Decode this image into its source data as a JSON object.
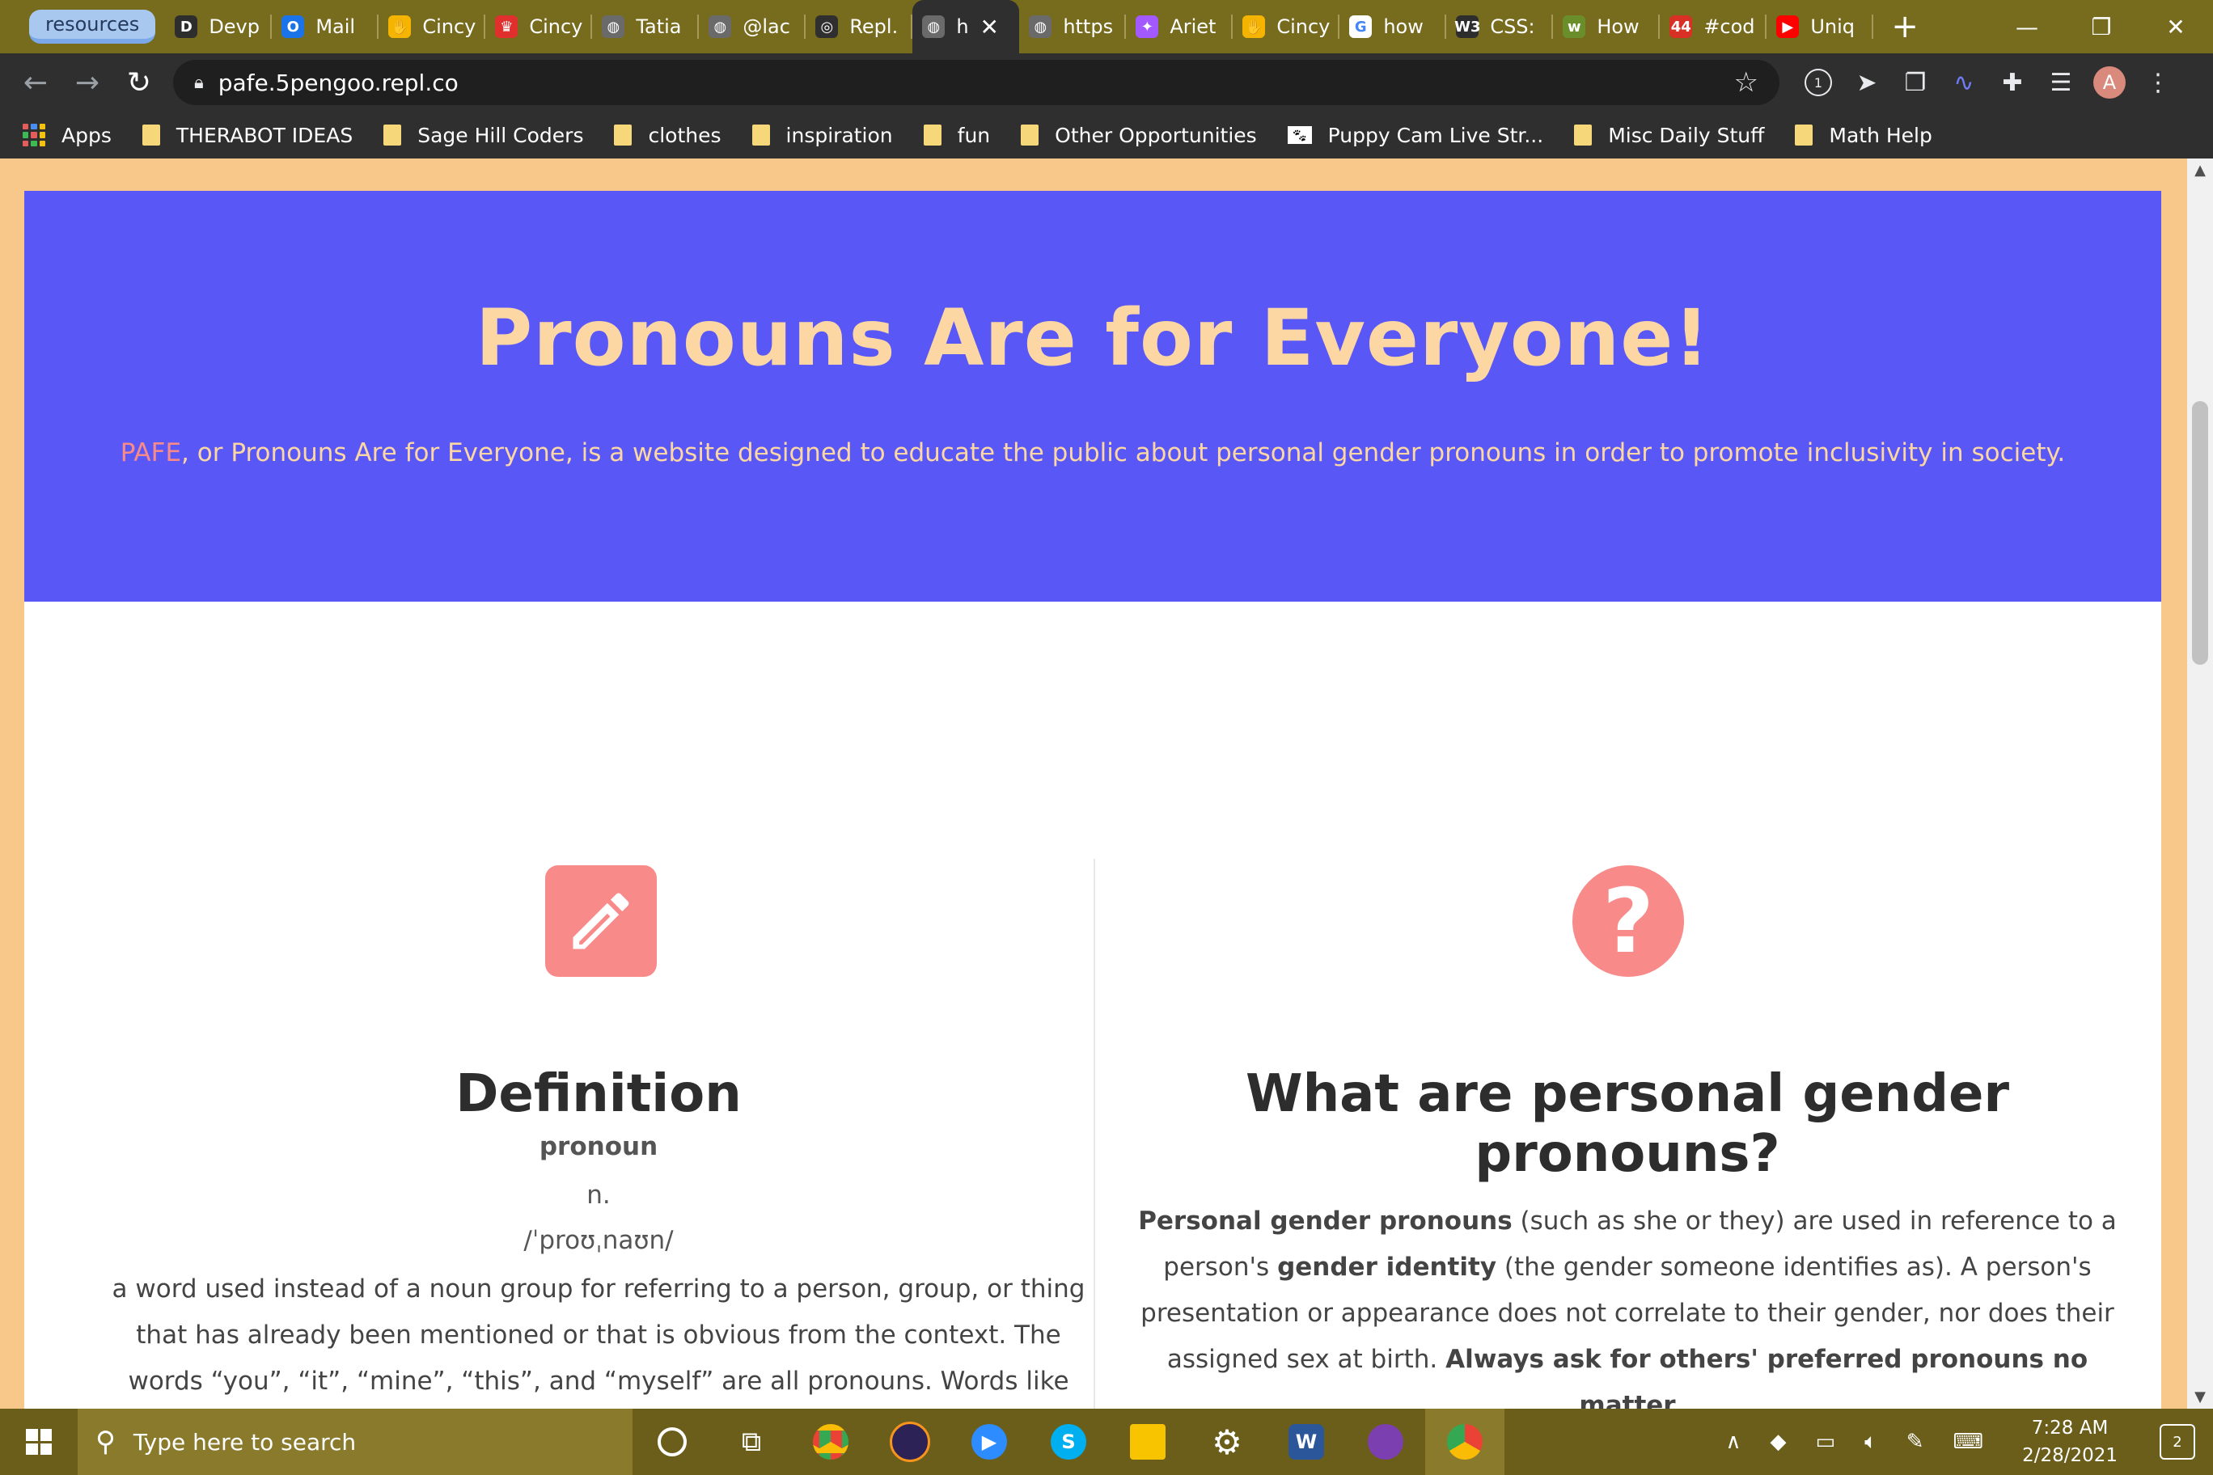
{
  "browser": {
    "tab_group": "resources",
    "tabs": [
      {
        "title": "Devp",
        "icon": "devpost-icon",
        "color": "#2d2d2d",
        "glyph": "D"
      },
      {
        "title": "Mail",
        "icon": "outlook-icon",
        "color": "#1a73e8",
        "glyph": "O"
      },
      {
        "title": "Cincy",
        "icon": "hackathon-icon",
        "color": "#f4b400",
        "glyph": "✋"
      },
      {
        "title": "Cincy",
        "icon": "crown-icon",
        "color": "#e0302e",
        "glyph": "♛"
      },
      {
        "title": "Tatia",
        "icon": "globe-icon",
        "color": "#6a6a6a",
        "glyph": "◍"
      },
      {
        "title": "@lac",
        "icon": "globe-icon",
        "color": "#6a6a6a",
        "glyph": "◍"
      },
      {
        "title": "Repl.",
        "icon": "replit-icon",
        "color": "#2f2f2f",
        "glyph": "◎"
      },
      {
        "title": "h",
        "icon": "globe-icon",
        "color": "#6a6a6a",
        "glyph": "◍",
        "active": true
      },
      {
        "title": "https",
        "icon": "globe-icon",
        "color": "#6a6a6a",
        "glyph": "◍"
      },
      {
        "title": "Ariet",
        "icon": "figma-icon",
        "color": "#a259ff",
        "glyph": "✦"
      },
      {
        "title": "Cincy",
        "icon": "hackathon-icon",
        "color": "#f4b400",
        "glyph": "✋"
      },
      {
        "title": "how",
        "icon": "google-icon",
        "color": "#ffffff",
        "glyph": "G"
      },
      {
        "title": "CSS:",
        "icon": "w3schools-icon",
        "color": "#2d2d2d",
        "glyph": "W3"
      },
      {
        "title": "How",
        "icon": "wikihow-icon",
        "color": "#6a8f2a",
        "glyph": "w"
      },
      {
        "title": "#cod",
        "icon": "calendar-icon",
        "color": "#d93025",
        "glyph": "44"
      },
      {
        "title": "Uniq",
        "icon": "youtube-icon",
        "color": "#ff0000",
        "glyph": "▶"
      }
    ],
    "url": "pafe.5pengoo.repl.co",
    "profile_initial": "A",
    "extension_badge": "1",
    "bookmarks": [
      {
        "label": "Apps",
        "type": "apps"
      },
      {
        "label": "THERABOT IDEAS",
        "type": "folder"
      },
      {
        "label": "Sage Hill Coders",
        "type": "folder"
      },
      {
        "label": "clothes",
        "type": "folder"
      },
      {
        "label": "inspiration",
        "type": "folder"
      },
      {
        "label": "fun",
        "type": "folder"
      },
      {
        "label": "Other Opportunities",
        "type": "folder"
      },
      {
        "label": "Puppy Cam Live Str...",
        "type": "site"
      },
      {
        "label": "Misc Daily Stuff",
        "type": "folder"
      },
      {
        "label": "Math Help",
        "type": "folder"
      }
    ]
  },
  "page": {
    "hero": {
      "title": "Pronouns Are for Everyone!",
      "brand": "PAFE",
      "subtitle": ", or Pronouns Are for Everyone, is a website designed to educate the public about personal gender pronouns in order to promote inclusivity in society."
    },
    "definition": {
      "heading": "Definition",
      "word": "pronoun",
      "part_of_speech": "n.",
      "ipa": "/ˈproʊˌnaʊn/",
      "text": "a word used instead of a noun group for referring to a person, group, or thing that has already been mentioned or that is obvious from the context. The words “you”, “it”, “mine”, “this”, and “myself” are all pronouns. Words like"
    },
    "what_are": {
      "heading": "What are personal gender pronouns?",
      "p1_bold": "Personal gender pronouns",
      "p1_rest": " (such as she or they) are used in reference to a person's ",
      "p1_bold2": "gender identity",
      "p1_rest2": " (the gender someone identifies as). A person's presentation or appearance does not correlate to their gender, nor does their assigned sex at birth. ",
      "p1_bold3": "Always ask for others' preferred pronouns no matter"
    }
  },
  "taskbar": {
    "search_placeholder": "Type here to search",
    "time": "7:28 AM",
    "date": "2/28/2021",
    "notification_count": "2"
  },
  "colors": {
    "page_bg": "#f8c88a",
    "hero_bg": "#5957f6",
    "hero_text": "#fcd7a4",
    "accent": "#f98a8a"
  }
}
